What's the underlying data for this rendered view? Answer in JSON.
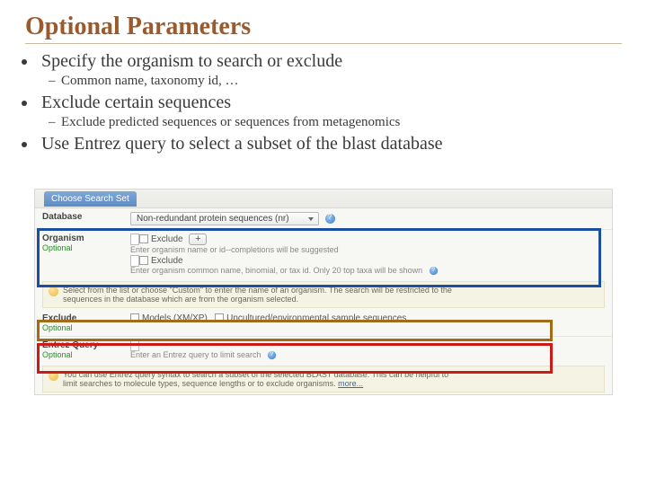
{
  "title": "Optional Parameters",
  "bullets": {
    "b1": "Specify the organism to search or exclude",
    "b1s1": "Common name, taxonomy id, …",
    "b2": "Exclude certain sequences",
    "b2s1": "Exclude predicted sequences or sequences from metagenomics",
    "b3": "Use Entrez query to select a subset of the blast database"
  },
  "panel": {
    "tab": "Choose Search Set",
    "database": {
      "label": "Database",
      "value": "Non-redundant protein sequences (nr)"
    },
    "organism": {
      "label": "Organism",
      "optional": "Optional",
      "exclude": "Exclude",
      "hint1": "Enter organism name or id--completions will be suggested",
      "hint2": "Enter organism common name, binomial, or tax id. Only 20 top taxa will be shown"
    },
    "info1a": "Select from the list or choose \"Custom\" to enter the name of an organism. The search will be restricted to the",
    "info1b": "sequences in the database which are from the organism selected.",
    "exclude": {
      "label": "Exclude",
      "optional": "Optional",
      "opt1": "Models (XM/XP)",
      "opt2": "Uncultured/environmental sample sequences"
    },
    "entrez": {
      "label": "Entrez Query",
      "optional": "Optional",
      "hint": "Enter an Entrez query to limit search"
    },
    "info2a": "You can use Entrez query syntax to search a subset of the selected BLAST database. This can be helpful to",
    "info2b": "limit searches to molecule types, sequence lengths or to exclude organisms.",
    "more": "more..."
  }
}
